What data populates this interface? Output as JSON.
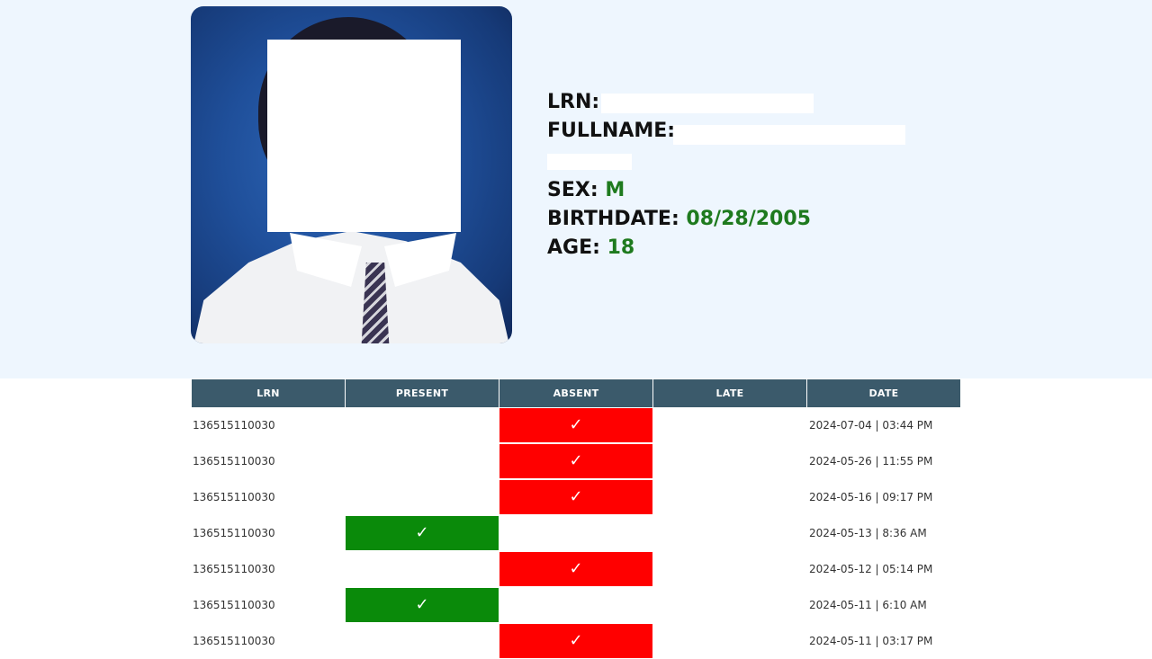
{
  "profile": {
    "lrn_label": "LRN:",
    "lrn_value": "",
    "fullname_label": "FULLNAME:",
    "fullname_value": "",
    "sex_label": "SEX:",
    "sex_value": "M",
    "birthdate_label": "BIRTHDATE:",
    "birthdate_value": "08/28/2005",
    "age_label": "AGE:",
    "age_value": "18"
  },
  "table": {
    "headers": [
      "LRN",
      "PRESENT",
      "ABSENT",
      "LATE",
      "DATE"
    ],
    "check_glyph": "✓",
    "rows": [
      {
        "lrn": "136515110030",
        "status": "absent",
        "date": "2024-07-04 | 03:44 PM"
      },
      {
        "lrn": "136515110030",
        "status": "absent",
        "date": "2024-05-26 | 11:55 PM"
      },
      {
        "lrn": "136515110030",
        "status": "absent",
        "date": "2024-05-16 | 09:17 PM"
      },
      {
        "lrn": "136515110030",
        "status": "present",
        "date": "2024-05-13 | 8:36 AM"
      },
      {
        "lrn": "136515110030",
        "status": "absent",
        "date": "2024-05-12 | 05:14 PM"
      },
      {
        "lrn": "136515110030",
        "status": "present",
        "date": "2024-05-11 | 6:10 AM"
      },
      {
        "lrn": "136515110030",
        "status": "absent",
        "date": "2024-05-11 | 03:17 PM"
      }
    ]
  },
  "colors": {
    "present": "#0a8a0a",
    "absent": "#ff0000",
    "header": "#3b5a6b",
    "value_text": "#1e7a1e",
    "profile_background": "#eef6fe"
  },
  "icons": {
    "check": "checkmark-icon"
  }
}
